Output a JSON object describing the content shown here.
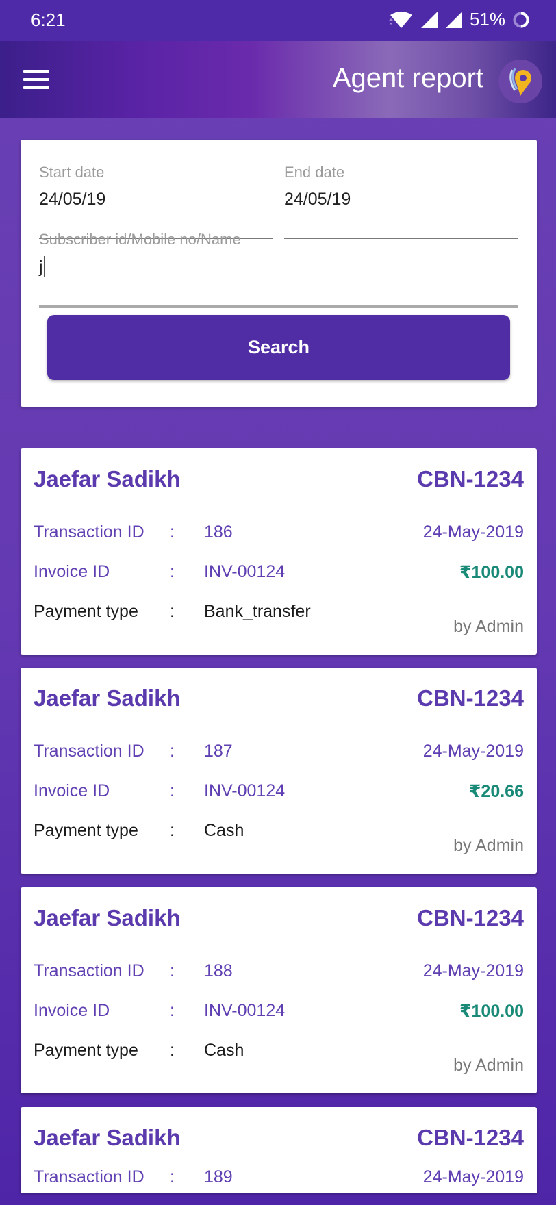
{
  "status_bar": {
    "time": "6:21",
    "battery_percent": "51%",
    "icons": [
      "wifi-icon",
      "signal-icon",
      "signal-icon",
      "battery-icon"
    ]
  },
  "app_bar": {
    "title": "Agent report",
    "menu_icon": "menu-icon",
    "logo_icon": "location-pin-logo"
  },
  "filters": {
    "start_date": {
      "label": "Start date",
      "value": "24/05/19"
    },
    "end_date": {
      "label": "End date",
      "value": "24/05/19"
    },
    "subscriber": {
      "label": "Subscriber id/Mobile no/Name",
      "value": "j"
    },
    "search_label": "Search"
  },
  "colors": {
    "primary": "#502ca5",
    "accent_text": "#5b3aae",
    "amount": "#1a8a78"
  },
  "labels": {
    "transaction_id": "Transaction ID",
    "invoice_id": "Invoice ID",
    "payment_type": "Payment type",
    "colon": ":"
  },
  "transactions": [
    {
      "name": "Jaefar Sadikh",
      "code": "CBN-1234",
      "transaction_id": "186",
      "date": "24-May-2019",
      "invoice_id": "INV-00124",
      "amount": "₹100.00",
      "payment_type": "Bank_transfer",
      "by": "by Admin"
    },
    {
      "name": "Jaefar Sadikh",
      "code": "CBN-1234",
      "transaction_id": "187",
      "date": "24-May-2019",
      "invoice_id": "INV-00124",
      "amount": "₹20.66",
      "payment_type": "Cash",
      "by": "by Admin"
    },
    {
      "name": "Jaefar Sadikh",
      "code": "CBN-1234",
      "transaction_id": "188",
      "date": "24-May-2019",
      "invoice_id": "INV-00124",
      "amount": "₹100.00",
      "payment_type": "Cash",
      "by": "by Admin"
    },
    {
      "name": "Jaefar Sadikh",
      "code": "CBN-1234",
      "transaction_id": "189",
      "date": "24-May-2019"
    }
  ]
}
